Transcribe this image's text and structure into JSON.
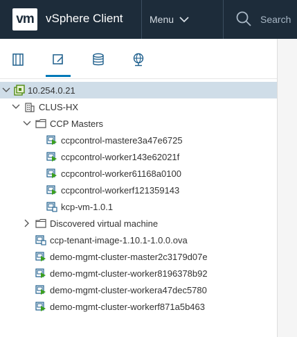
{
  "header": {
    "logo_text": "vm",
    "app_title": "vSphere Client",
    "menu_label": "Menu",
    "search_placeholder": "Search"
  },
  "toolbar": {
    "tabs": [
      {
        "name": "hosts-and-clusters",
        "icon": "hosts-clusters-icon"
      },
      {
        "name": "vms-and-templates",
        "icon": "vms-templates-icon",
        "active": true
      },
      {
        "name": "storage",
        "icon": "storage-icon"
      },
      {
        "name": "networking",
        "icon": "network-icon"
      }
    ]
  },
  "tree": {
    "items": [
      {
        "label": "10.254.0.21",
        "type": "vcenter",
        "expanded": true,
        "selected": true
      },
      {
        "label": "CLUS-HX",
        "type": "datacenter",
        "expanded": true
      },
      {
        "label": "CCP Masters",
        "type": "folder",
        "expanded": true
      },
      {
        "label": "ccpcontrol-mastere3a47e6725",
        "type": "vm-running"
      },
      {
        "label": "ccpcontrol-worker143e62021f",
        "type": "vm-running"
      },
      {
        "label": "ccpcontrol-worker61168a0100",
        "type": "vm-running"
      },
      {
        "label": "ccpcontrol-workerf121359143",
        "type": "vm-running"
      },
      {
        "label": "kcp-vm-1.0.1",
        "type": "vm-template"
      },
      {
        "label": "Discovered virtual machine",
        "type": "folder",
        "expanded": false
      },
      {
        "label": "ccp-tenant-image-1.10.1-1.0.0.ova",
        "type": "vm-template"
      },
      {
        "label": "demo-mgmt-cluster-master2c3179d07e",
        "type": "vm-running"
      },
      {
        "label": "demo-mgmt-cluster-worker8196378b92",
        "type": "vm-running"
      },
      {
        "label": "demo-mgmt-cluster-workera47dec5780",
        "type": "vm-running"
      },
      {
        "label": "demo-mgmt-cluster-workerf871a5b463",
        "type": "vm-running"
      }
    ]
  },
  "colors": {
    "header_bg": "#1d2c3a",
    "accent": "#0079b8",
    "selected_row": "#cfdde8",
    "vm_running_green": "#3b9f1f"
  }
}
